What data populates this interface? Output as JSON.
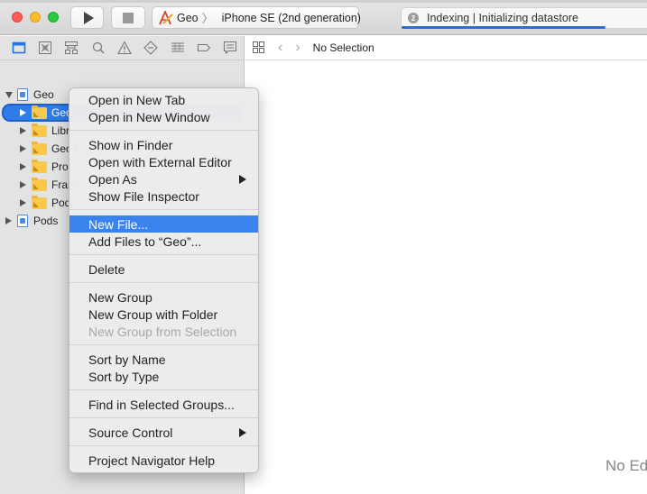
{
  "toolbar": {
    "run_icon": "play-icon",
    "stop_icon": "stop-icon",
    "scheme": {
      "project": "Geo",
      "separator": "〉",
      "device": "iPhone SE (2nd generation)"
    },
    "activity": {
      "badge": "2",
      "text": "Indexing | Initializing datastore",
      "progress_percent": 83
    }
  },
  "navigator": {
    "tabs": [
      {
        "icon": "folder-icon",
        "active": true
      },
      {
        "icon": "source-control-icon",
        "active": false
      },
      {
        "icon": "symbol-hierarchy-icon",
        "active": false
      },
      {
        "icon": "search-icon",
        "active": false
      },
      {
        "icon": "warning-icon",
        "active": false
      },
      {
        "icon": "test-diamond-icon",
        "active": false
      },
      {
        "icon": "debug-list-icon",
        "active": false
      },
      {
        "icon": "breakpoint-tag-icon",
        "active": false
      },
      {
        "icon": "report-bubble-icon",
        "active": false
      }
    ],
    "tree": [
      {
        "label": "Geo",
        "type": "project",
        "expanded": true
      },
      {
        "label": "Geo",
        "type": "folder",
        "selected": true
      },
      {
        "label": "Libra",
        "type": "folder"
      },
      {
        "label": "GeoT",
        "type": "folder"
      },
      {
        "label": "Prod",
        "type": "folder"
      },
      {
        "label": "Fram",
        "type": "folder"
      },
      {
        "label": "Pods",
        "type": "folder"
      },
      {
        "label": "Pods",
        "type": "project",
        "expanded": false
      }
    ]
  },
  "editor": {
    "jump_bar": {
      "back": "‹",
      "forward": "›",
      "title": "No Selection"
    },
    "placeholder": "No Ed"
  },
  "context_menu": {
    "groups": [
      [
        {
          "label": "Open in New Tab"
        },
        {
          "label": "Open in New Window"
        }
      ],
      [
        {
          "label": "Show in Finder"
        },
        {
          "label": "Open with External Editor"
        },
        {
          "label": "Open As",
          "submenu": true
        },
        {
          "label": "Show File Inspector"
        }
      ],
      [
        {
          "label": "New File...",
          "highlighted": true
        },
        {
          "label": "Add Files to “Geo”..."
        }
      ],
      [
        {
          "label": "Delete"
        }
      ],
      [
        {
          "label": "New Group"
        },
        {
          "label": "New Group with Folder"
        },
        {
          "label": "New Group from Selection",
          "disabled": true
        }
      ],
      [
        {
          "label": "Sort by Name"
        },
        {
          "label": "Sort by Type"
        }
      ],
      [
        {
          "label": "Find in Selected Groups..."
        }
      ],
      [
        {
          "label": "Source Control",
          "submenu": true
        }
      ],
      [
        {
          "label": "Project Navigator Help"
        }
      ]
    ]
  }
}
